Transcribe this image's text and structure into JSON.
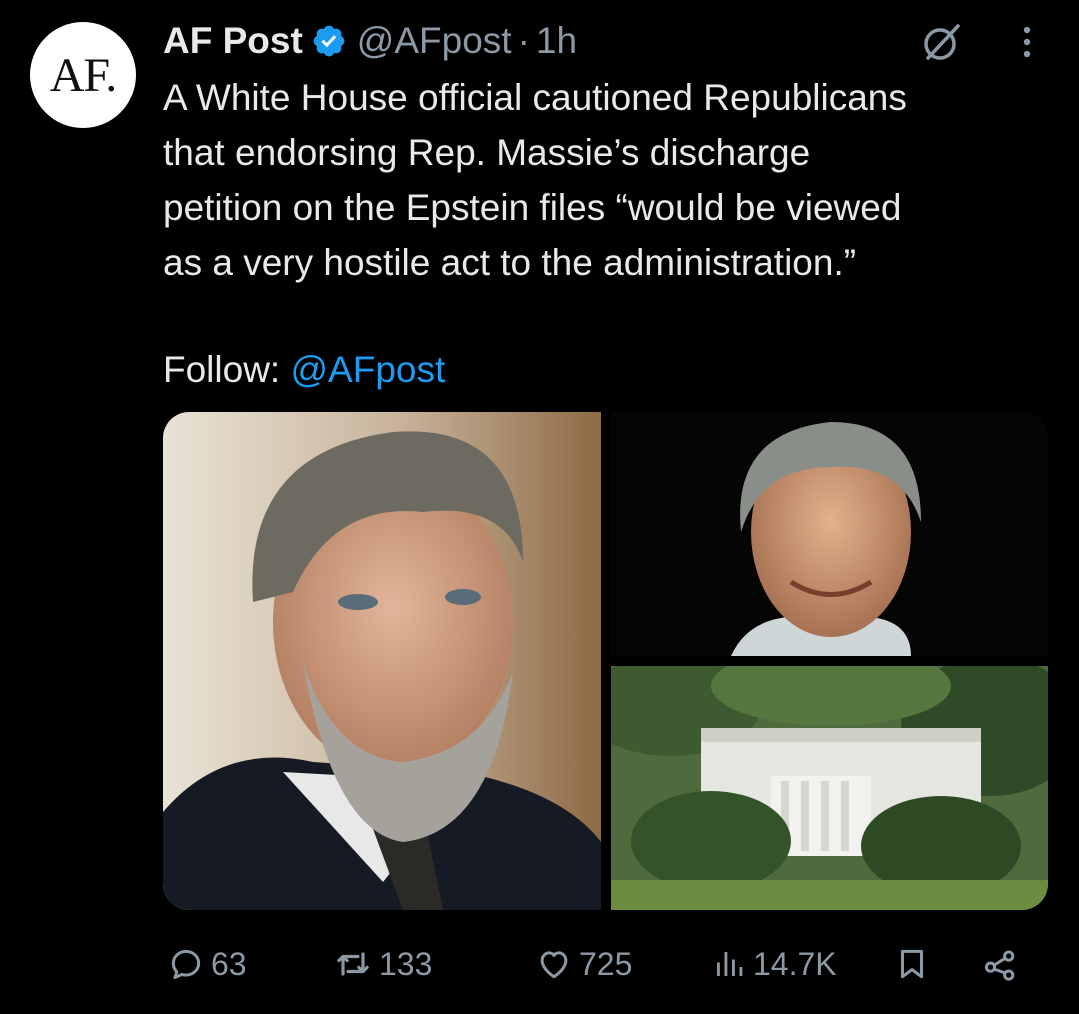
{
  "author": {
    "avatar_text": "AF.",
    "name": "AF Post",
    "verified": true,
    "handle": "@AFpost",
    "separator": "·",
    "time": "1h"
  },
  "tweet": {
    "text": "A White House official cautioned Republicans\nthat endorsing Rep. Massie’s discharge\npetition on the Epstein files “would be viewed\nas a very hostile act to the administration.”",
    "follow_label": "Follow: ",
    "follow_mention": "@AFpost"
  },
  "media": {
    "images": [
      {
        "name": "man-portrait-photo"
      },
      {
        "name": "man-smiling-photo"
      },
      {
        "name": "white-house-photo"
      }
    ]
  },
  "actions": {
    "reply_count": "63",
    "repost_count": "133",
    "like_count": "725",
    "views_count": "14.7K"
  },
  "icons": {
    "verified": "verified-badge-icon",
    "grok": "grok-icon",
    "more": "more-vertical-icon",
    "reply": "reply-icon",
    "repost": "repost-icon",
    "like": "heart-icon",
    "views": "views-icon",
    "bookmark": "bookmark-icon",
    "share": "share-icon"
  },
  "colors": {
    "background": "#000000",
    "text": "#e7e9ea",
    "secondary": "#8b98a5",
    "accent": "#1d9bf0"
  }
}
